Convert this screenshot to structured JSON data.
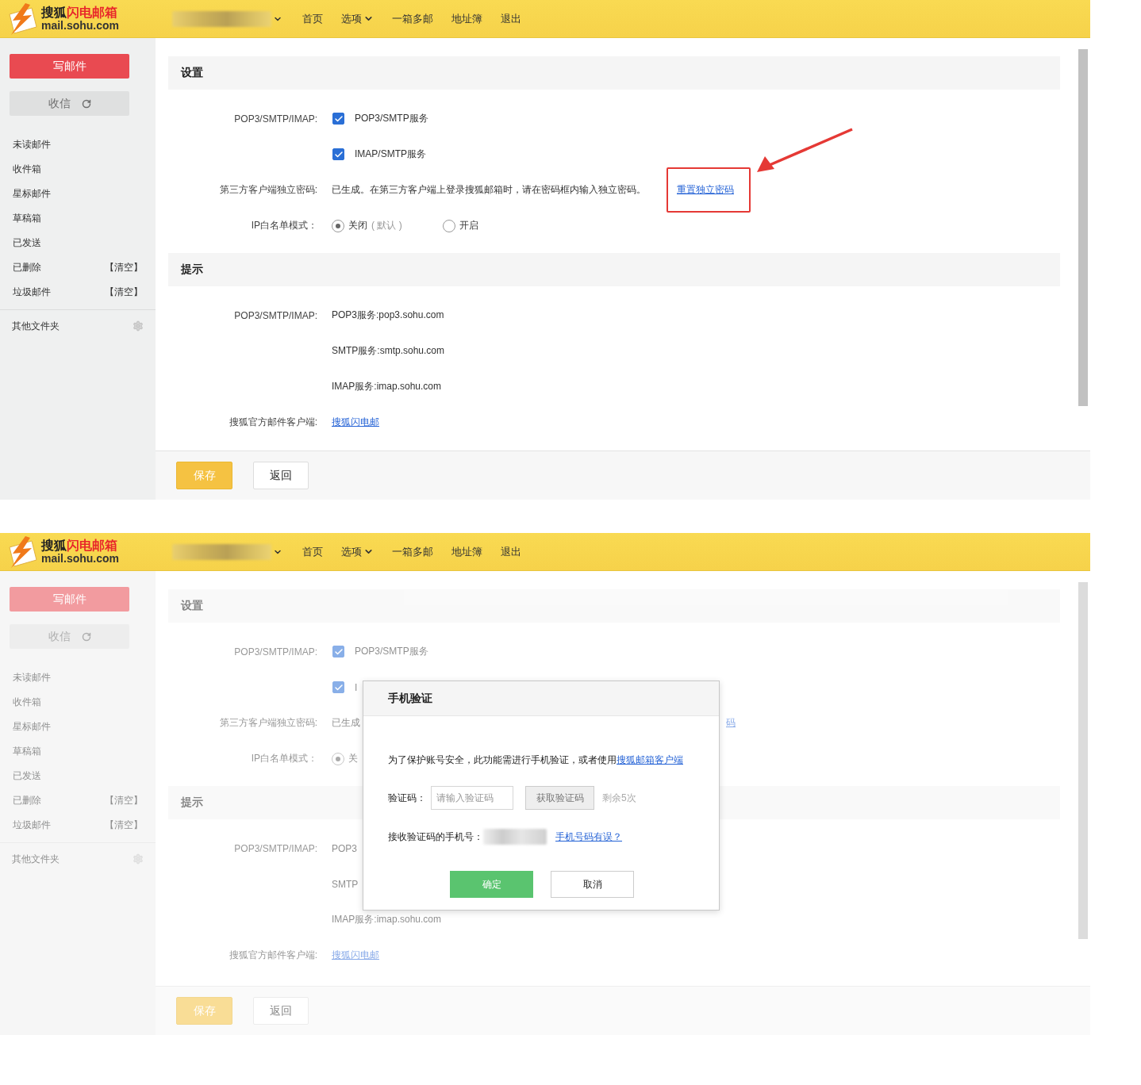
{
  "screens": [
    {
      "header": {
        "logo": {
          "title_dark": "搜狐",
          "title_red": "闪电邮箱",
          "subtitle": "mail.sohu.com"
        },
        "nav": [
          {
            "label": "首页",
            "menu": false
          },
          {
            "label": "选项",
            "menu": true
          },
          {
            "label": "一箱多邮",
            "menu": false
          },
          {
            "label": "地址簿",
            "menu": false
          },
          {
            "label": "退出",
            "menu": false
          }
        ]
      },
      "sidebar": {
        "compose": "写邮件",
        "receive": "收信",
        "folders": [
          {
            "name": "未读邮件"
          },
          {
            "name": "收件箱"
          },
          {
            "name": "星标邮件"
          },
          {
            "name": "草稿箱"
          },
          {
            "name": "已发送"
          },
          {
            "name": "已删除",
            "action": "【清空】"
          },
          {
            "name": "垃圾邮件",
            "action": "【清空】"
          }
        ],
        "other": "其他文件夹"
      },
      "sections": [
        {
          "title": "设置",
          "rows": [
            {
              "label": "POP3/SMTP/IMAP:",
              "kind": "checkbox",
              "text": "POP3/SMTP服务",
              "checked": true
            },
            {
              "kind": "checkbox",
              "text": "IMAP/SMTP服务",
              "checked": true
            },
            {
              "label": "第三方客户端独立密码:",
              "kind": "text-link",
              "text": "已生成。在第三方客户端上登录搜狐邮箱时，请在密码框内输入独立密码。",
              "link": "重置独立密码",
              "highlighted": true
            },
            {
              "label": "IP白名单模式：",
              "kind": "radio",
              "options": [
                {
                  "label": "关闭",
                  "note": "( 默认 )",
                  "selected": true
                },
                {
                  "label": "开启",
                  "selected": false
                }
              ]
            }
          ]
        },
        {
          "title": "提示",
          "rows": [
            {
              "label": "POP3/SMTP/IMAP:",
              "kind": "text",
              "text": "POP3服务:pop3.sohu.com"
            },
            {
              "kind": "text",
              "text": "SMTP服务:smtp.sohu.com"
            },
            {
              "kind": "text",
              "text": "IMAP服务:imap.sohu.com"
            },
            {
              "label": "搜狐官方邮件客户端:",
              "kind": "link",
              "text": "搜狐闪电邮"
            }
          ]
        }
      ],
      "footer": {
        "save": "保存",
        "back": "返回"
      }
    },
    {
      "header": {
        "logo": {
          "title_dark": "搜狐",
          "title_red": "闪电邮箱",
          "subtitle": "mail.sohu.com"
        },
        "nav": [
          {
            "label": "首页",
            "menu": false
          },
          {
            "label": "选项",
            "menu": true
          },
          {
            "label": "一箱多邮",
            "menu": false
          },
          {
            "label": "地址簿",
            "menu": false
          },
          {
            "label": "退出",
            "menu": false
          }
        ]
      },
      "sidebar": {
        "compose": "写邮件",
        "receive": "收信",
        "folders": [
          {
            "name": "未读邮件"
          },
          {
            "name": "收件箱"
          },
          {
            "name": "星标邮件"
          },
          {
            "name": "草稿箱"
          },
          {
            "name": "已发送"
          },
          {
            "name": "已删除",
            "action": "【清空】"
          },
          {
            "name": "垃圾邮件",
            "action": "【清空】"
          }
        ],
        "other": "其他文件夹"
      },
      "sections": [
        {
          "title": "设置",
          "rows": [
            {
              "label": "POP3/SMTP/IMAP:",
              "kind": "checkbox",
              "text": "POP3/SMTP服务",
              "checked": true
            },
            {
              "kind": "checkbox",
              "text": "I",
              "checked": true
            },
            {
              "label": "第三方客户端独立密码:",
              "kind": "text-link",
              "text": "已生成",
              "link": "码",
              "highlighted": false
            },
            {
              "label": "IP白名单模式：",
              "kind": "radio",
              "options": [
                {
                  "label": "关",
                  "selected": true
                }
              ]
            }
          ]
        },
        {
          "title": "提示",
          "rows": [
            {
              "label": "POP3/SMTP/IMAP:",
              "kind": "text",
              "text": "POP3"
            },
            {
              "kind": "text",
              "text": "SMTP"
            },
            {
              "kind": "text",
              "text": "IMAP服务:imap.sohu.com"
            },
            {
              "label": "搜狐官方邮件客户端:",
              "kind": "link",
              "text": "搜狐闪电邮"
            }
          ]
        }
      ],
      "footer": {
        "save": "保存",
        "back": "返回"
      },
      "dialog": {
        "title": "手机验证",
        "message": "为了保护账号安全，此功能需进行手机验证，或者使用",
        "message_link": "搜狐邮箱客户端",
        "code_label": "验证码：",
        "code_placeholder": "请输入验证码",
        "get_code": {
          "label": "获取验证码",
          "disabled": true
        },
        "remaining": "剩余5次",
        "phone_label": "接收验证码的手机号：",
        "phone_link": "手机号码有误？",
        "confirm": "确定",
        "cancel": "取消"
      }
    }
  ]
}
